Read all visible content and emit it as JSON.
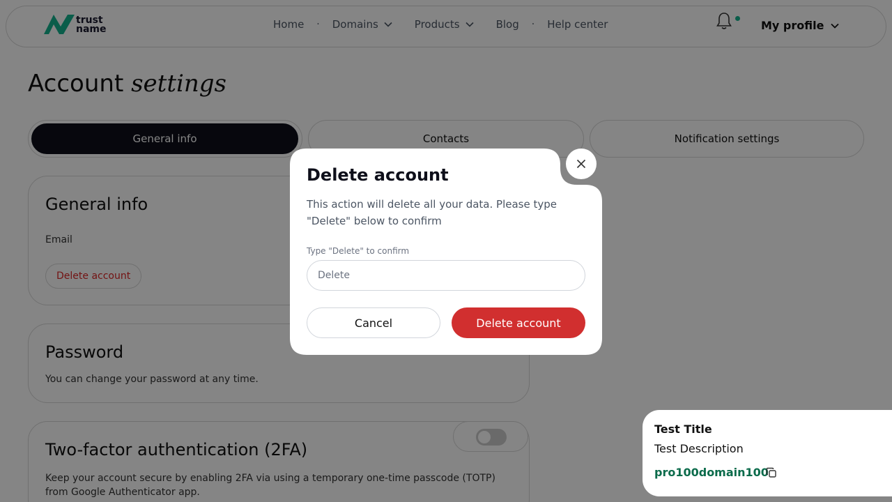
{
  "header": {
    "logo": {
      "line1": "trust",
      "line2": "name"
    },
    "nav": [
      {
        "label": "Home"
      },
      {
        "label": "Domains"
      },
      {
        "label": "Products"
      },
      {
        "label": "Blog"
      },
      {
        "label": "Help center"
      }
    ],
    "separator": "·",
    "profile_label": "My profile"
  },
  "page": {
    "title_regular": "Account",
    "title_italic": "settings"
  },
  "tabs": [
    {
      "label": "General info",
      "active": true
    },
    {
      "label": "Contacts",
      "active": false
    },
    {
      "label": "Notification settings",
      "active": false
    }
  ],
  "general_card": {
    "title": "General info",
    "email_label": "Email",
    "delete_label": "Delete account"
  },
  "password_card": {
    "title": "Password",
    "description": "You can change your password at any time."
  },
  "twofa_card": {
    "title": "Two-factor authentication (2FA)",
    "description": "Keep your account secure by enabling 2FA via using a temporary one-time passcode (TOTP) from Google Authenticator app.",
    "enabled": false
  },
  "modal": {
    "title": "Delete account",
    "description": "This action will delete all your data. Please type \"Delete\" below to confirm",
    "field_label": "Type \"Delete\" to confirm",
    "field_placeholder": "Delete",
    "field_value": "",
    "cancel_label": "Cancel",
    "confirm_label": "Delete account"
  },
  "toast": {
    "title": "Test Title",
    "description": "Test Description",
    "code": "pro100domain100"
  },
  "colors": {
    "brand": "#14b28f",
    "danger": "#d12f2f",
    "dark": "#0e0f1a",
    "code": "#0b6b4b"
  }
}
